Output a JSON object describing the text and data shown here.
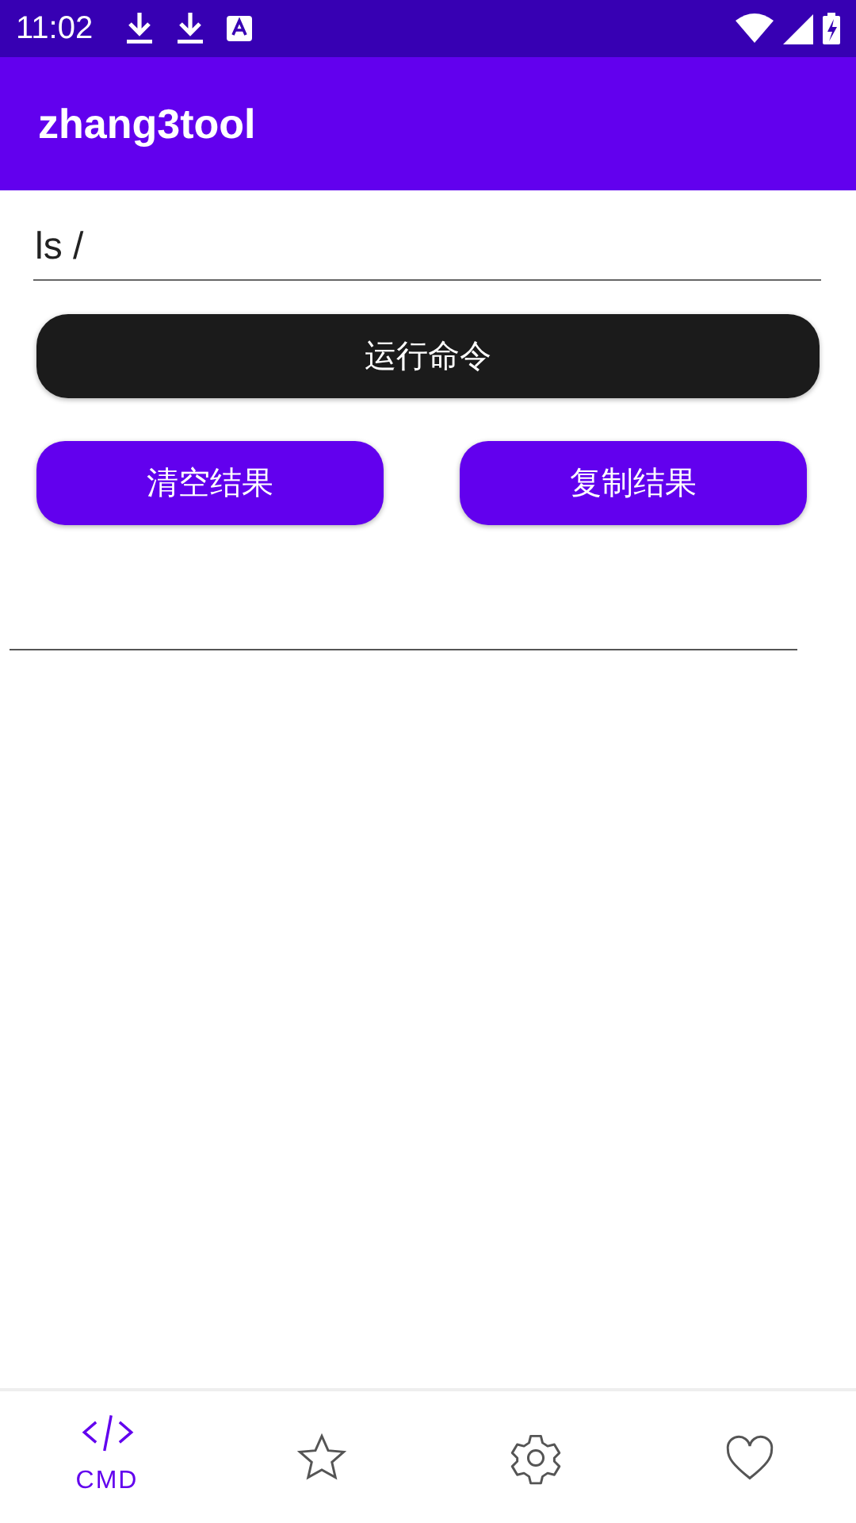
{
  "status_bar": {
    "time": "11:02",
    "notifications": [
      {
        "kind": "download"
      },
      {
        "kind": "download"
      },
      {
        "kind": "keyboard"
      }
    ],
    "system": [
      {
        "kind": "wifi"
      },
      {
        "kind": "signal"
      },
      {
        "kind": "battery"
      }
    ]
  },
  "app_bar": {
    "title": "zhang3tool"
  },
  "command_field": {
    "value": "ls /"
  },
  "run_button": {
    "label": "运行命令"
  },
  "actions": [
    {
      "label": "清空结果"
    },
    {
      "label": "复制结果"
    }
  ],
  "bottom_nav": [
    {
      "kind": "code",
      "label": "CMD",
      "selected": true
    },
    {
      "kind": "star",
      "selected": false
    },
    {
      "kind": "settings",
      "selected": false
    },
    {
      "kind": "heart",
      "selected": false
    }
  ]
}
